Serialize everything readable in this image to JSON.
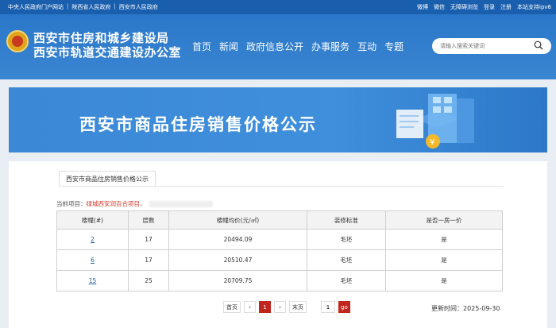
{
  "topbar": {
    "links_left": [
      "中央人民政府门户网站",
      "陕西省人民政府",
      "西安市人民政府"
    ],
    "links_right": [
      "微博",
      "微信",
      "无障碍浏览",
      "登录",
      "注册",
      "本站支持ipv6"
    ]
  },
  "header": {
    "title_line1": "西安市住房和城乡建设局",
    "title_line2": "西安市轨道交通建设办公室",
    "nav": [
      "首页",
      "新闻",
      "政府信息公开",
      "办事服务",
      "互动",
      "专题"
    ],
    "search_placeholder": "请输入搜索关键词"
  },
  "banner": {
    "title": "西安市商品住房销售价格公示"
  },
  "content": {
    "tab_label": "西安市商品住房销售价格公示",
    "current_label": "当前项目：",
    "current_project": "绿城西安润百合项目，",
    "table": {
      "headers": [
        "楼幢(#)",
        "层数",
        "楼幢均价(元/㎡)",
        "装修标准",
        "是否一房一价"
      ],
      "rows": [
        {
          "building": "2",
          "floors": "17",
          "avg_price": "20494.09",
          "decoration": "毛坯",
          "one_price": "是"
        },
        {
          "building": "6",
          "floors": "17",
          "avg_price": "20510.47",
          "decoration": "毛坯",
          "one_price": "是"
        },
        {
          "building": "15",
          "floors": "25",
          "avg_price": "20709.75",
          "decoration": "毛坯",
          "one_price": "是"
        }
      ]
    },
    "pagination": {
      "first": "首页",
      "prev": "‹",
      "current_page": "1",
      "next": "›",
      "last": "末页",
      "goto_value": "1",
      "go": "go"
    },
    "update_time": "更新时间：2025-09-30"
  },
  "colors": {
    "primary": "#1a5fae",
    "header": "#2a77c9",
    "accent_red": "#c0261e"
  }
}
